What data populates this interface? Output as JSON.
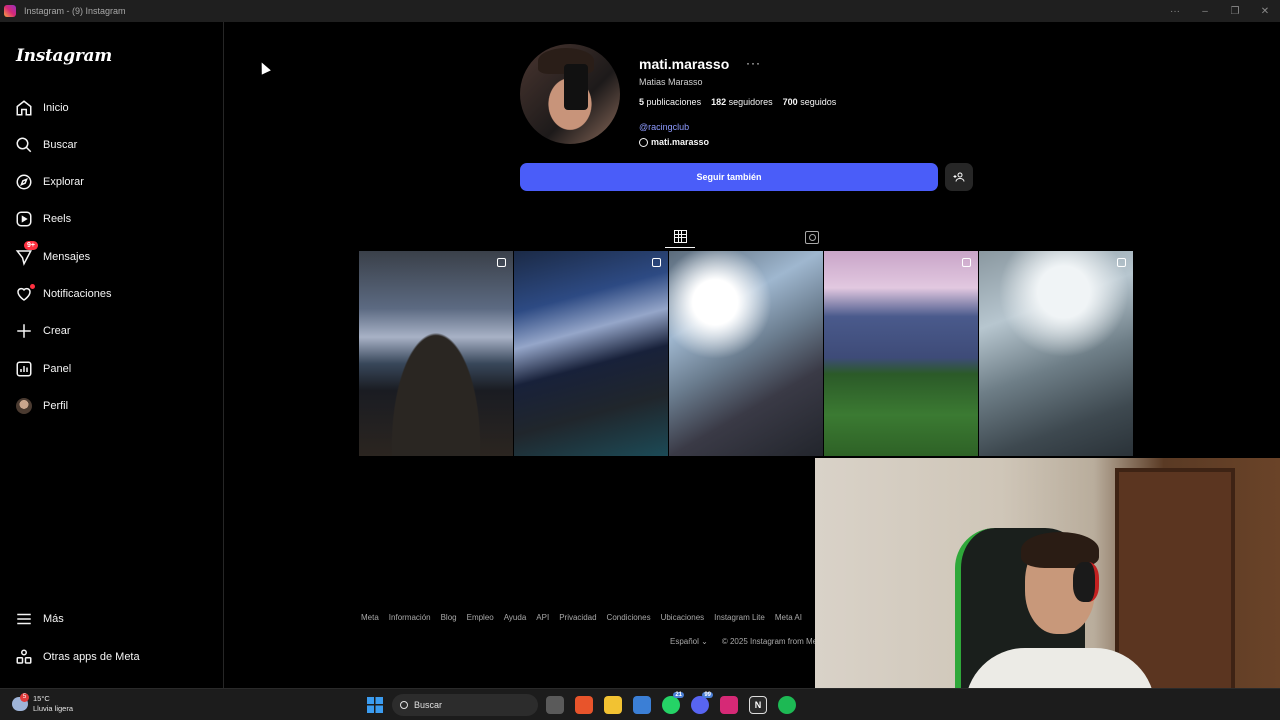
{
  "window": {
    "title": "Instagram - (9) Instagram",
    "controls": [
      "···",
      "–",
      "❐",
      "✕"
    ]
  },
  "sidebar": {
    "logo": "Instagram",
    "items": [
      {
        "label": "Inicio",
        "icon": "home-icon"
      },
      {
        "label": "Buscar",
        "icon": "search-icon"
      },
      {
        "label": "Explorar",
        "icon": "compass-icon"
      },
      {
        "label": "Reels",
        "icon": "reels-icon"
      },
      {
        "label": "Mensajes",
        "icon": "messenger-icon",
        "badge": "9+"
      },
      {
        "label": "Notificaciones",
        "icon": "heart-icon"
      },
      {
        "label": "Crear",
        "icon": "plus-icon"
      },
      {
        "label": "Panel",
        "icon": "chart-icon"
      },
      {
        "label": "Perfil",
        "icon": "avatar"
      }
    ],
    "bottom_items": [
      {
        "label": "Más",
        "icon": "menu-icon"
      },
      {
        "label": "Otras apps de Meta",
        "icon": "meta-apps-icon"
      }
    ]
  },
  "profile": {
    "username": "mati.marasso",
    "more": "···",
    "full_name": "Matias Marasso",
    "posts_count": "5",
    "posts_label": "publicaciones",
    "followers_count": "182",
    "followers_label": "seguidores",
    "following_count": "700",
    "following_label": "seguidos",
    "mention": "@racingclub",
    "threads_handle": "mati.marasso",
    "follow_button": "Seguir también",
    "add_user_button": "+"
  },
  "tabs": [
    {
      "name": "posts",
      "icon": "grid-icon",
      "active": true
    },
    {
      "name": "tagged",
      "icon": "tagged-icon",
      "active": false
    }
  ],
  "posts": [
    {
      "multiple": true
    },
    {
      "multiple": true
    },
    {
      "multiple": false
    },
    {
      "multiple": true
    },
    {
      "multiple": true
    }
  ],
  "footer": {
    "links": [
      "Meta",
      "Información",
      "Blog",
      "Empleo",
      "Ayuda",
      "API",
      "Privacidad",
      "Condiciones",
      "Ubicaciones",
      "Instagram Lite",
      "Meta AI"
    ],
    "language": "Español",
    "copyright": "© 2025 Instagram from Me"
  },
  "taskbar": {
    "temperature": "15°C",
    "weather": "Lluvia ligera",
    "weather_badge": "5",
    "search_label": "Buscar",
    "apps": [
      {
        "name": "task-view",
        "label": "",
        "color": "#5a5a5a"
      },
      {
        "name": "brave",
        "label": "",
        "color": "#e8542b"
      },
      {
        "name": "file-explorer",
        "label": "",
        "color": "#f2c232"
      },
      {
        "name": "ms-store",
        "label": "",
        "color": "#3b7fd6"
      },
      {
        "name": "whatsapp",
        "label": "",
        "color": "#25d366",
        "count": "21"
      },
      {
        "name": "discord",
        "label": "",
        "color": "#5865f2",
        "count": "99"
      },
      {
        "name": "instagram",
        "label": "",
        "color": "#d62976"
      },
      {
        "name": "notion",
        "label": "N",
        "color": "#2a2a2a"
      },
      {
        "name": "spotify",
        "label": "",
        "color": "#1db954"
      }
    ]
  },
  "colors": {
    "accent": "#4a5df9",
    "badge": "#ff3040",
    "link": "#8e9bff"
  }
}
